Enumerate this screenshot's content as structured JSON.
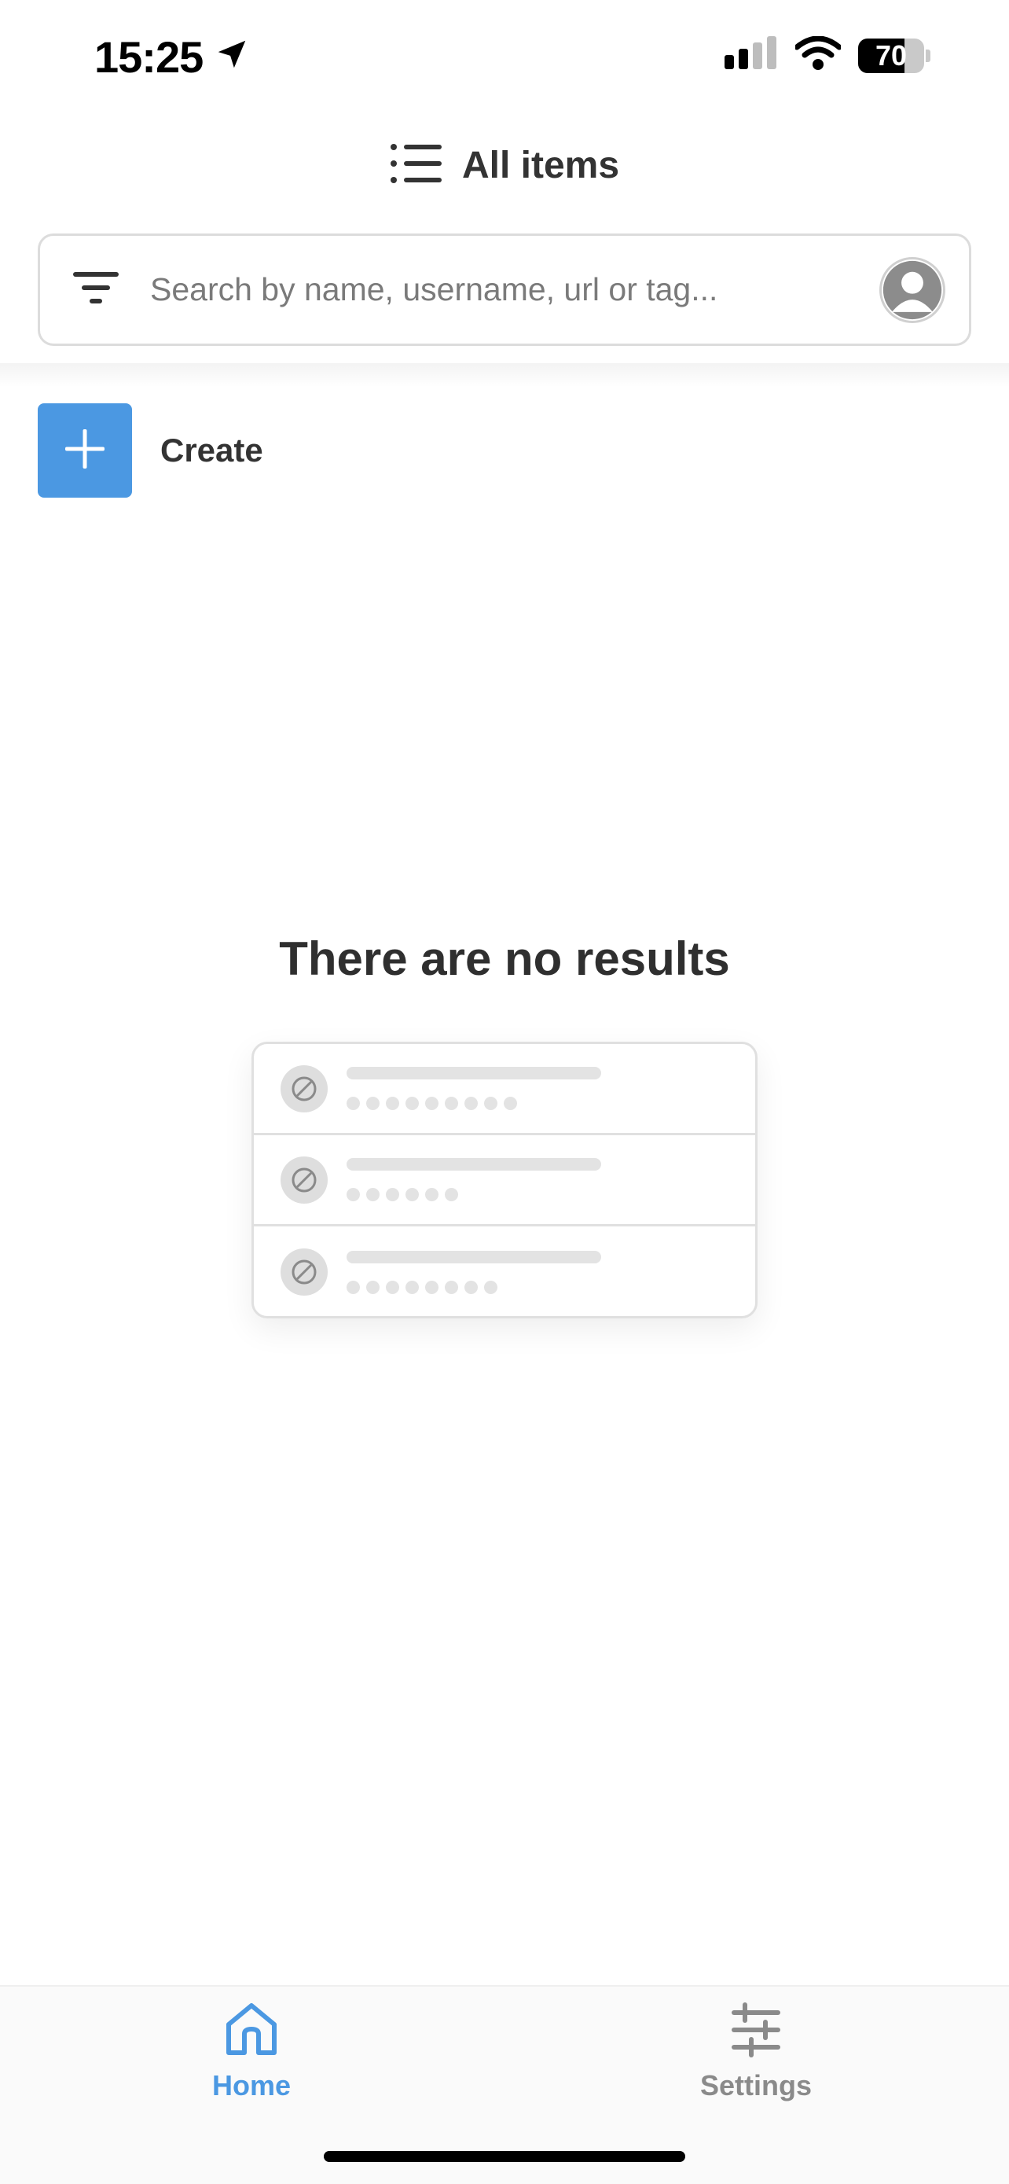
{
  "status_bar": {
    "time": "15:25",
    "battery": "70",
    "icons": [
      "location-arrow-icon",
      "signal-icon",
      "wifi-icon",
      "battery-icon"
    ]
  },
  "header": {
    "title": "All items",
    "icon": "list-icon"
  },
  "search": {
    "placeholder": "Search by name, username, url or tag...",
    "value": "",
    "filter_icon": "filter-icon",
    "avatar_icon": "user-avatar-icon"
  },
  "create": {
    "label": "Create",
    "icon": "plus-icon"
  },
  "empty_state": {
    "title": "There are no results",
    "placeholder_rows": [
      {
        "dots": 9
      },
      {
        "dots": 6
      },
      {
        "dots": 8
      }
    ]
  },
  "tabs": [
    {
      "label": "Home",
      "icon": "home-icon",
      "active": true
    },
    {
      "label": "Settings",
      "icon": "sliders-icon",
      "active": false
    }
  ],
  "colors": {
    "accent": "#4b98e2",
    "text": "#333333",
    "muted": "#8a8a8a",
    "placeholder_gray": "#e3e3e3"
  }
}
